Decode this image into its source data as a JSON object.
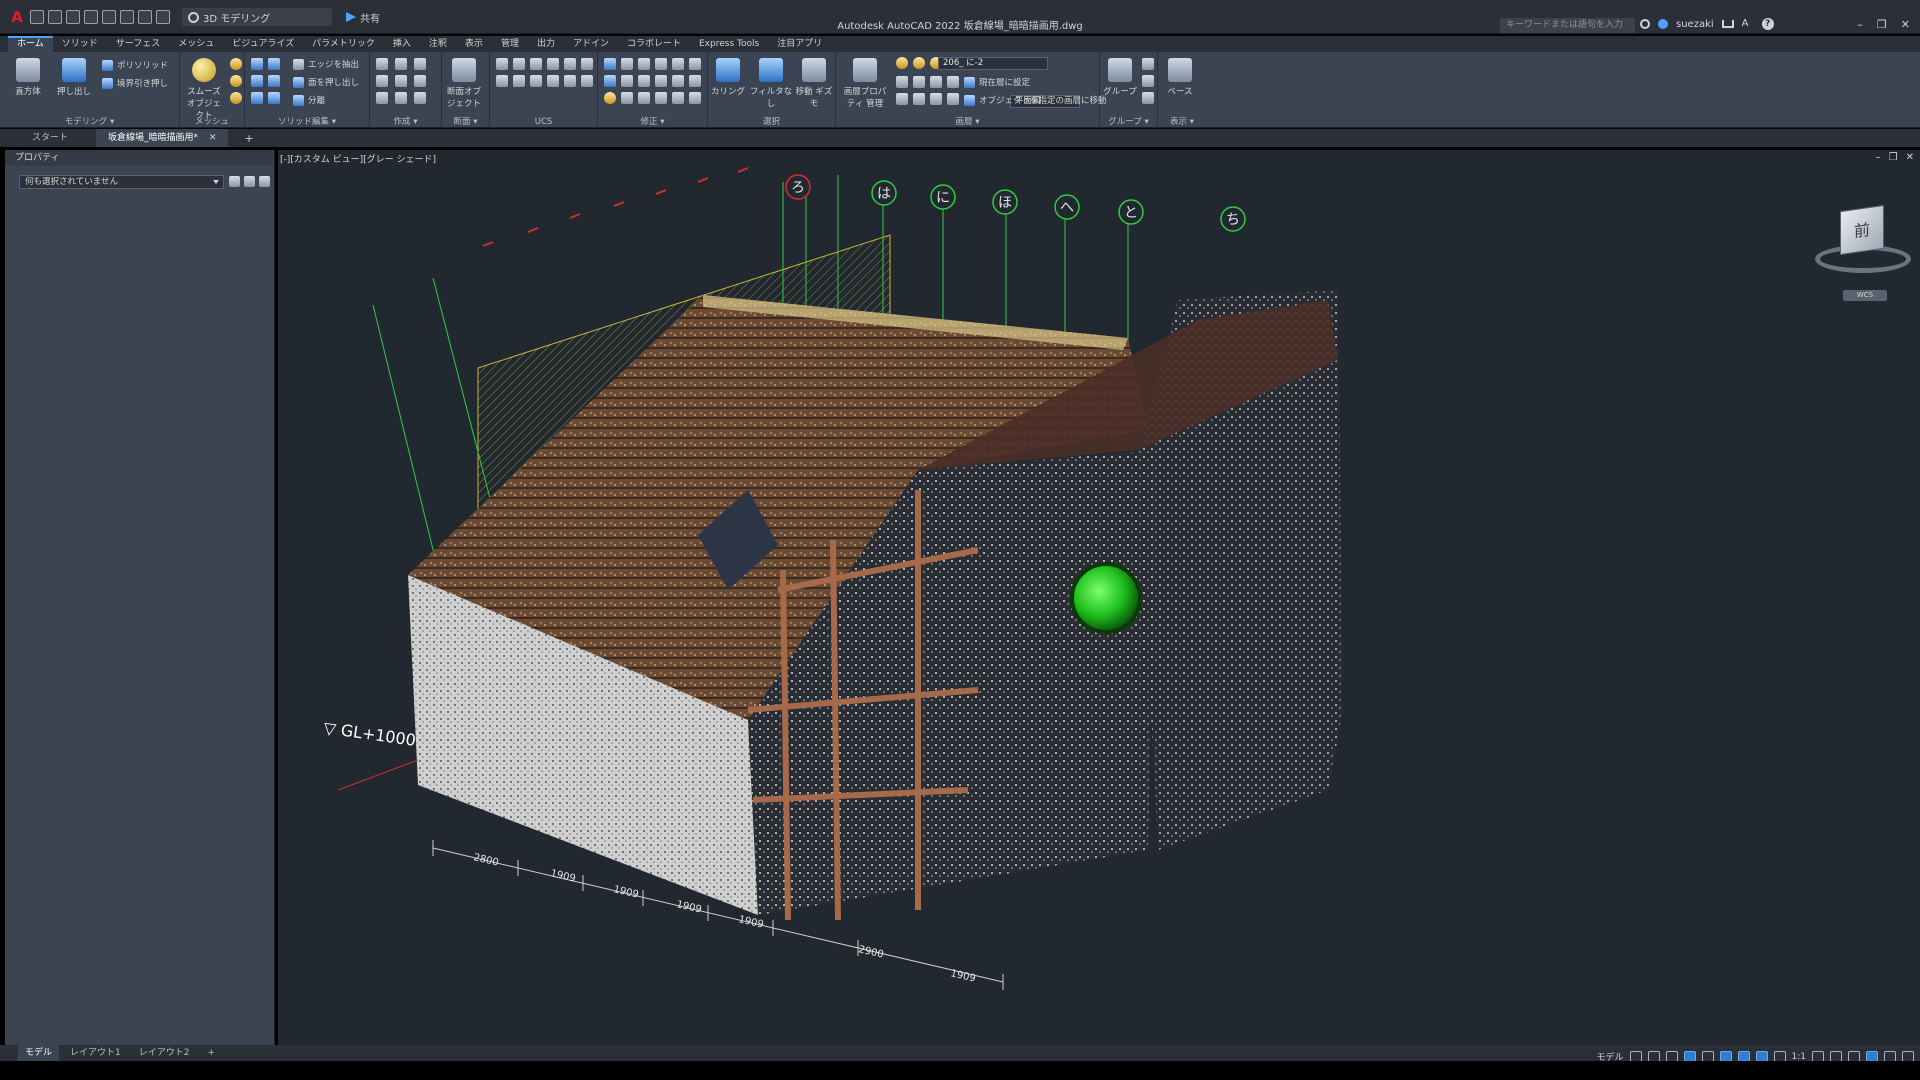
{
  "title_bar": {
    "app_logo": "A",
    "workspace": "3D モデリング",
    "share": "共有",
    "window_title": "Autodesk AutoCAD 2022   坂倉線場_暗暗描画用.dwg",
    "search_placeholder": "キーワードまたは語句を入力",
    "username": "suezaki",
    "window_controls": [
      "–",
      "❐",
      "✕"
    ]
  },
  "ribbon_tabs": [
    "ホーム",
    "ソリッド",
    "サーフェス",
    "メッシュ",
    "ビジュアライズ",
    "パラメトリック",
    "挿入",
    "注釈",
    "表示",
    "管理",
    "出力",
    "アドイン",
    "コラボレート",
    "Express Tools",
    "注目アプリ"
  ],
  "ribbon": {
    "modeling": {
      "label": "モデリング ▾",
      "box": "直方体",
      "extrude": "押し出し",
      "polysolid": "ポリソリッド",
      "presspull": "境界引き押し"
    },
    "mesh": {
      "label": "メッシュ",
      "smooth": "スムーズ オブジェクト"
    },
    "solid_edit": {
      "label": "ソリッド編集 ▾",
      "extract_edges": "エッジを抽出",
      "extrude_faces": "面を押し出し",
      "separate": "分離"
    },
    "draw": {
      "label": "作成 ▾"
    },
    "section": {
      "label": "断面 ▾",
      "section_plane": "断面オブ ジェクト"
    },
    "ucs": {
      "label": "UCS",
      "plane": "平面図"
    },
    "modify": {
      "label": "修正 ▾"
    },
    "selection": {
      "label": "選択",
      "culling": "カリング",
      "filter": "フィルタなし",
      "gizmo": "移動 ギズモ"
    },
    "layers": {
      "label": "画層 ▾",
      "layer_props": "画層プロパティ 管理",
      "current_layer": "206_ に-2",
      "set_current": "現在層に設定",
      "move_to_layer": "オブジェクトを指定の画層に移動"
    },
    "groups": {
      "label": "グループ ▾",
      "group": "グループ"
    },
    "view": {
      "label": "表示 ▾",
      "base": "ベース"
    }
  },
  "document_tabs": [
    {
      "label": "スタート"
    },
    {
      "label": "坂倉線場_暗暗描画用*",
      "close": "✕"
    }
  ],
  "new_tab": "+",
  "properties": {
    "title": "プロパティ",
    "selection": "何も選択されていません"
  },
  "viewport": {
    "label": "[-][カスタム ビュー][グレー シェード]",
    "controls": [
      "–",
      "❐",
      "✕"
    ],
    "viewcube_face": "前",
    "wcs": "WCS",
    "grid_markers": [
      "ろ",
      "は",
      "に",
      "ほ",
      "へ",
      "と",
      "ち"
    ],
    "level_label": "▽ GL+1000",
    "dimensions": [
      "2800",
      "1909",
      "1909",
      "1909",
      "1909",
      "2900",
      "1909"
    ]
  },
  "layout_tabs": [
    "モデル",
    "レイアウト1",
    "レイアウト2",
    "+"
  ],
  "status": {
    "model": "モデル",
    "scale": "1:1"
  },
  "colors": {
    "accent": "#4aa3ff",
    "grid_green": "#2ecc40",
    "dimension_red": "#d32f2f",
    "target_green": "#24d424"
  }
}
